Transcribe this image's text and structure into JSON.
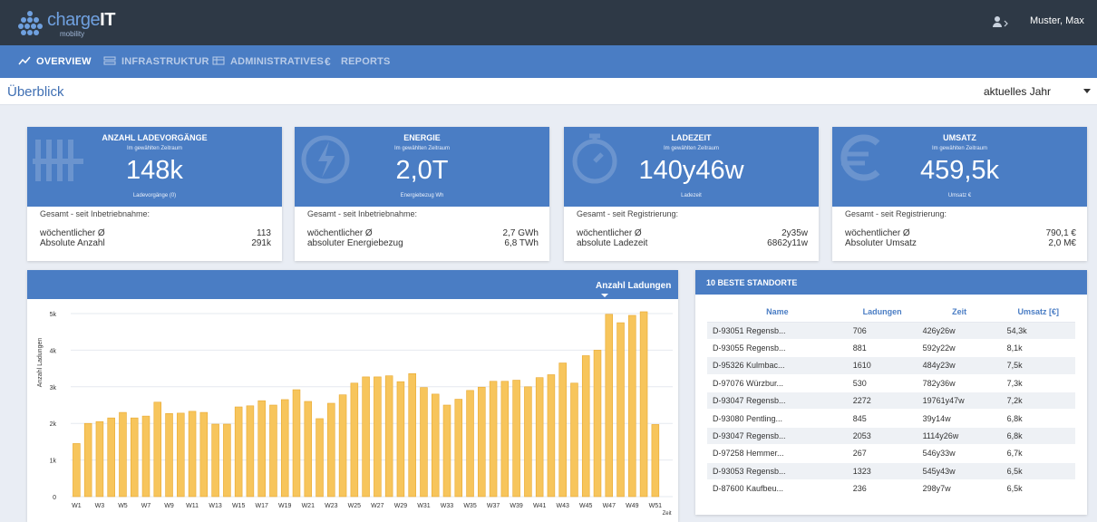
{
  "app": {
    "name": "chargeIT",
    "name_part1": "charge",
    "name_part2": "IT",
    "tagline": "mobility",
    "user": "Muster, Max"
  },
  "nav": [
    {
      "label": "OVERVIEW",
      "icon": "chart-line-icon",
      "active": true
    },
    {
      "label": "INFRASTRUKTUR",
      "icon": "infrastructure-icon",
      "active": false
    },
    {
      "label": "ADMINISTRATIVES",
      "icon": "calendar-icon",
      "active": false
    },
    {
      "label": "REPORTS",
      "icon": "euro-icon",
      "active": false
    }
  ],
  "page": {
    "title": "Überblick",
    "period": "aktuelles Jahr"
  },
  "cards": [
    {
      "title": "ANZAHL LADEVORGÄNGE",
      "subtitle": "Im gewählten Zeitraum",
      "value": "148k",
      "unit": "Ladevorgänge (0)",
      "footer": "Gesamt - seit Inbetriebnahme:",
      "rows": [
        {
          "label": "wöchentlicher Ø",
          "value": "113"
        },
        {
          "label": "Absolute Anzahl",
          "value": "291k"
        }
      ],
      "icon": "tally-icon"
    },
    {
      "title": "ENERGIE",
      "subtitle": "Im gewählten Zeitraum",
      "value": "2,0T",
      "unit": "Energiebezug Wh",
      "footer": "Gesamt - seit Inbetriebnahme:",
      "rows": [
        {
          "label": "wöchentlicher Ø",
          "value": "2,7 GWh"
        },
        {
          "label": "absoluter Energiebezug",
          "value": "6,8 TWh"
        }
      ],
      "icon": "lightning-icon"
    },
    {
      "title": "LADEZEIT",
      "subtitle": "Im gewählten Zeitraum",
      "value": "140y46w",
      "unit": "Ladezeit",
      "footer": "Gesamt - seit Registrierung:",
      "rows": [
        {
          "label": "wöchentlicher Ø",
          "value": "2y35w"
        },
        {
          "label": "absolute Ladezeit",
          "value": "6862y11w"
        }
      ],
      "icon": "stopwatch-icon"
    },
    {
      "title": "UMSATZ",
      "subtitle": "Im gewählten Zeitraum",
      "value": "459,5k",
      "unit": "Umsatz €",
      "footer": "Gesamt - seit Registrierung:",
      "rows": [
        {
          "label": "wöchentlicher Ø",
          "value": "790,1 €"
        },
        {
          "label": "Absoluter Umsatz",
          "value": "2,0 M€"
        }
      ],
      "icon": "euro-icon"
    }
  ],
  "chart_panel": {
    "metric": "Anzahl Ladungen"
  },
  "chart_data": {
    "type": "bar",
    "ylabel": "Anzahl Ladungen",
    "xlabel": "Zeit",
    "ylim": [
      0,
      5000
    ],
    "yticks": [
      "0",
      "1k",
      "2k",
      "3k",
      "4k",
      "5k"
    ],
    "color": "#f7c55c",
    "categories": [
      "W1",
      "W2",
      "W3",
      "W4",
      "W5",
      "W6",
      "W7",
      "W8",
      "W9",
      "W10",
      "W11",
      "W12",
      "W13",
      "W14",
      "W15",
      "W16",
      "W17",
      "W18",
      "W19",
      "W20",
      "W21",
      "W22",
      "W23",
      "W24",
      "W25",
      "W26",
      "W27",
      "W28",
      "W29",
      "W30",
      "W31",
      "W32",
      "W33",
      "W34",
      "W35",
      "W36",
      "W37",
      "W38",
      "W39",
      "W40",
      "W41",
      "W42",
      "W43",
      "W44",
      "W45",
      "W46",
      "W47",
      "W48",
      "W49",
      "W50",
      "W51",
      "W1"
    ],
    "xtick_labels": [
      "W1",
      "W3",
      "W5",
      "W7",
      "W9",
      "W11",
      "W13",
      "W15",
      "W17",
      "W19",
      "W21",
      "W23",
      "W25",
      "W27",
      "W29",
      "W31",
      "W33",
      "W35",
      "W37",
      "W39",
      "W41",
      "W43",
      "W45",
      "W47",
      "W49",
      "W51",
      "W1"
    ],
    "values": [
      1450,
      2000,
      2050,
      2150,
      2300,
      2150,
      2200,
      2580,
      2270,
      2280,
      2330,
      2300,
      1980,
      1980,
      2450,
      2480,
      2620,
      2500,
      2650,
      2920,
      2600,
      2130,
      2550,
      2780,
      3100,
      3270,
      3270,
      3300,
      3140,
      3360,
      2980,
      2800,
      2500,
      2660,
      2900,
      2990,
      3150,
      3150,
      3180,
      3000,
      3250,
      3330,
      3650,
      3100,
      3850,
      4000,
      4980,
      4750,
      4950,
      5050,
      1970,
      0
    ]
  },
  "top_sites": {
    "title": "10 BESTE STANDORTE",
    "columns": [
      "Name",
      "Ladungen",
      "Zeit",
      "Umsatz [€]"
    ],
    "rows": [
      [
        "D-93051 Regensb...",
        "706",
        "426y26w",
        "54,3k"
      ],
      [
        "D-93055 Regensb...",
        "881",
        "592y22w",
        "8,1k"
      ],
      [
        "D-95326 Kulmbac...",
        "1610",
        "484y23w",
        "7,5k"
      ],
      [
        "D-97076 Würzbur...",
        "530",
        "782y36w",
        "7,3k"
      ],
      [
        "D-93047 Regensb...",
        "2272",
        "19761y47w",
        "7,2k"
      ],
      [
        "D-93080 Pentling...",
        "845",
        "39y14w",
        "6,8k"
      ],
      [
        "D-93047 Regensb...",
        "2053",
        "1114y26w",
        "6,8k"
      ],
      [
        "D-97258 Hemmer...",
        "267",
        "546y33w",
        "6,7k"
      ],
      [
        "D-93053 Regensb...",
        "1323",
        "545y43w",
        "6,5k"
      ],
      [
        "D-87600 Kaufbeu...",
        "236",
        "298y7w",
        "6,5k"
      ]
    ]
  }
}
